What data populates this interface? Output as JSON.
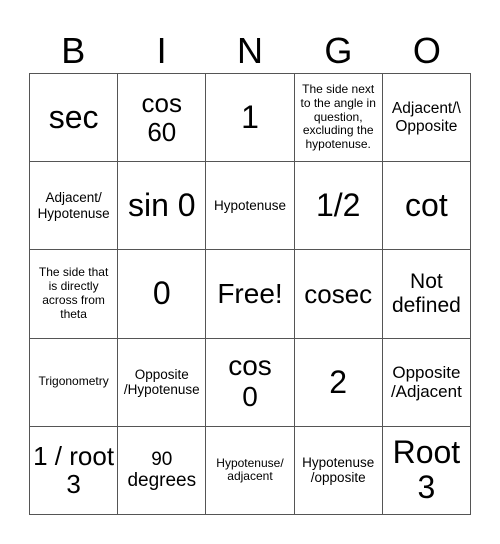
{
  "header": {
    "letters": [
      "B",
      "I",
      "N",
      "G",
      "O"
    ]
  },
  "cells": [
    [
      "sec",
      "cos 60",
      "1",
      "The side next to the angle in question, excluding the hypotenuse.",
      "Adjacent/\\ Opposite"
    ],
    [
      "Adjacent/ Hypotenuse",
      "sin 0",
      "Hypotenuse",
      "1/2",
      "cot"
    ],
    [
      "The side that is directly across from theta",
      "0",
      "Free!",
      "cosec",
      "Not defined"
    ],
    [
      "Trigonometry",
      "Opposite /Hypotenuse",
      "cos 0",
      "2",
      "Opposite /Adjacent"
    ],
    [
      "1 / root 3",
      "90 degrees",
      "Hypotenuse/ adjacent",
      "Hypotenuse /opposite",
      "Root 3"
    ]
  ]
}
